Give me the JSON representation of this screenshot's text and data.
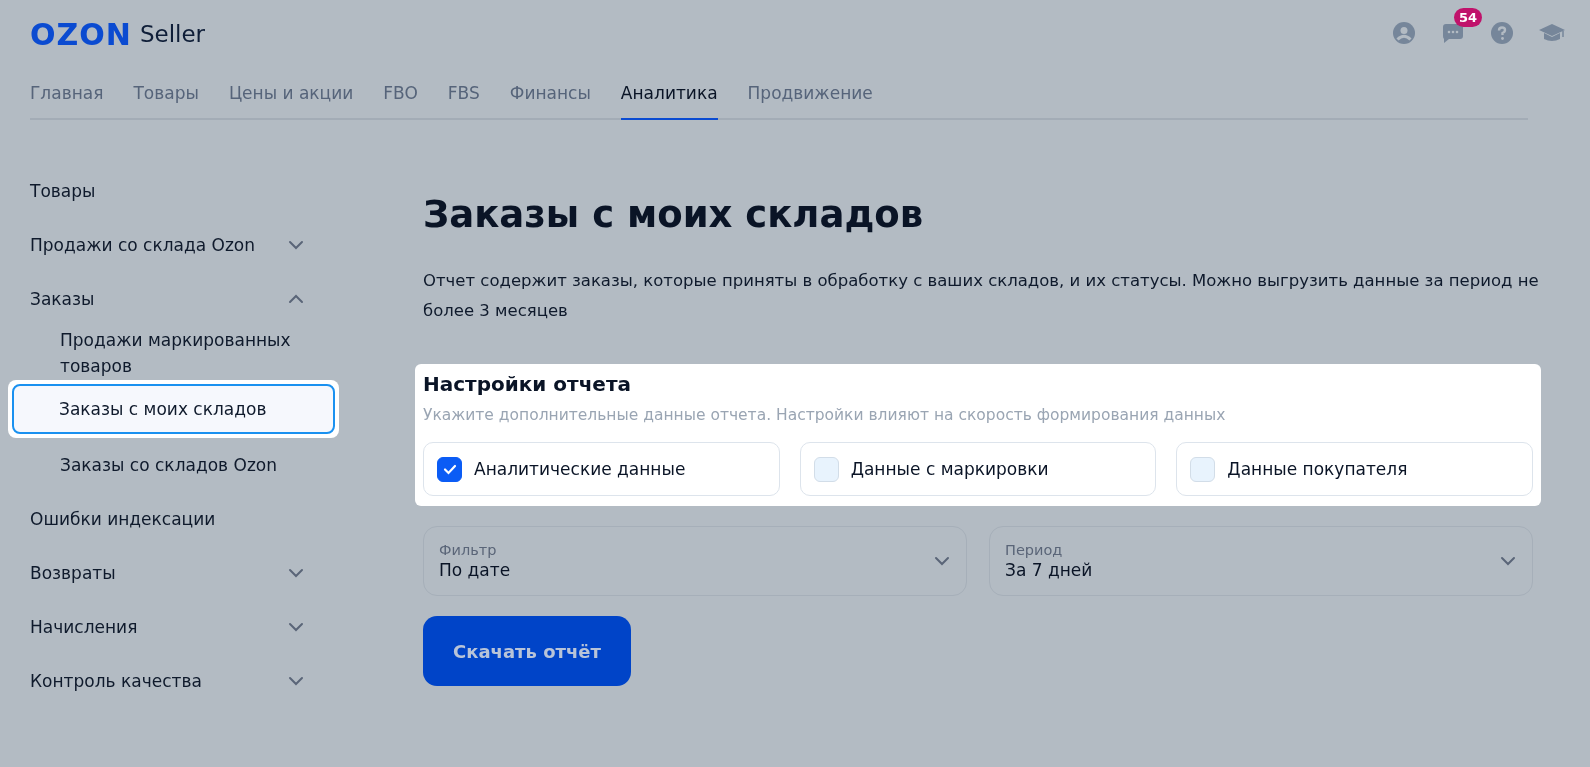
{
  "header": {
    "logo": "OZON",
    "product": "Seller",
    "messages_badge": "54"
  },
  "nav": [
    {
      "label": "Главная",
      "selected": false
    },
    {
      "label": "Товары",
      "selected": false
    },
    {
      "label": "Цены и акции",
      "selected": false
    },
    {
      "label": "FBO",
      "selected": false
    },
    {
      "label": "FBS",
      "selected": false
    },
    {
      "label": "Финансы",
      "selected": false
    },
    {
      "label": "Аналитика",
      "selected": true
    },
    {
      "label": "Продвижение",
      "selected": false
    }
  ],
  "sidebar": {
    "items": [
      {
        "label": "Товары"
      },
      {
        "label": "Продажи со склада Ozon",
        "expanded": false
      },
      {
        "label": "Заказы",
        "expanded": true,
        "children": [
          {
            "label": "Продажи маркированных товаров",
            "selected": false
          },
          {
            "label": "Заказы с моих складов",
            "selected": true
          },
          {
            "label": "Заказы со складов Ozon",
            "selected": false
          }
        ]
      },
      {
        "label": "Ошибки индексации"
      },
      {
        "label": "Возвраты",
        "expanded": false
      },
      {
        "label": "Начисления",
        "expanded": false
      },
      {
        "label": "Контроль качества",
        "expanded": false
      }
    ]
  },
  "page": {
    "title": "Заказы с моих складов",
    "description": "Отчет содержит заказы, которые приняты в обработку с ваших складов, и их статусы. Можно выгрузить данные за период не более 3 месяцев"
  },
  "settings": {
    "title": "Настройки отчета",
    "hint": "Укажите дополнительные данные отчета. Настройки влияют на скорость формирования данных",
    "options": [
      {
        "label": "Аналитические данные",
        "checked": true
      },
      {
        "label": "Данные с маркировки",
        "checked": false
      },
      {
        "label": "Данные покупателя",
        "checked": false
      }
    ]
  },
  "fields": [
    {
      "label": "Фильтр",
      "value": "По дате"
    },
    {
      "label": "Период",
      "value": "За 7 дней"
    }
  ],
  "download_button": "Скачать отчёт"
}
